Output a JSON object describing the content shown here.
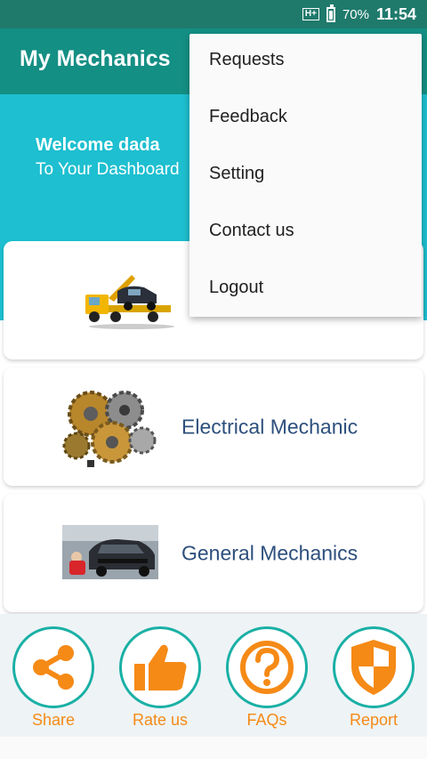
{
  "status_bar": {
    "network": "H+",
    "battery": "70%",
    "time": "11:54"
  },
  "app_bar": {
    "title": "My Mechanics"
  },
  "hero": {
    "welcome": "Welcome dada",
    "subtitle": "To Your Dashboard"
  },
  "cards": [
    {
      "label": "",
      "icon": "tow-truck-image"
    },
    {
      "label": "Electrical Mechanic",
      "icon": "gears-image"
    },
    {
      "label": "General Mechanics",
      "icon": "car-repair-image"
    }
  ],
  "actions": [
    {
      "label": "Share",
      "icon": "share-icon"
    },
    {
      "label": "Rate us",
      "icon": "thumbs-up-icon"
    },
    {
      "label": "FAQs",
      "icon": "question-icon"
    },
    {
      "label": "Report",
      "icon": "shield-icon"
    }
  ],
  "menu": {
    "items": [
      "Requests",
      "Feedback",
      "Setting",
      "Contact us",
      "Logout"
    ]
  },
  "colors": {
    "status": "#1f7a6c",
    "app_bar": "#148f84",
    "hero": "#1dbfd0",
    "accent": "#f58a16",
    "ring": "#1ab0a5",
    "card_text": "#2d4f7c"
  }
}
